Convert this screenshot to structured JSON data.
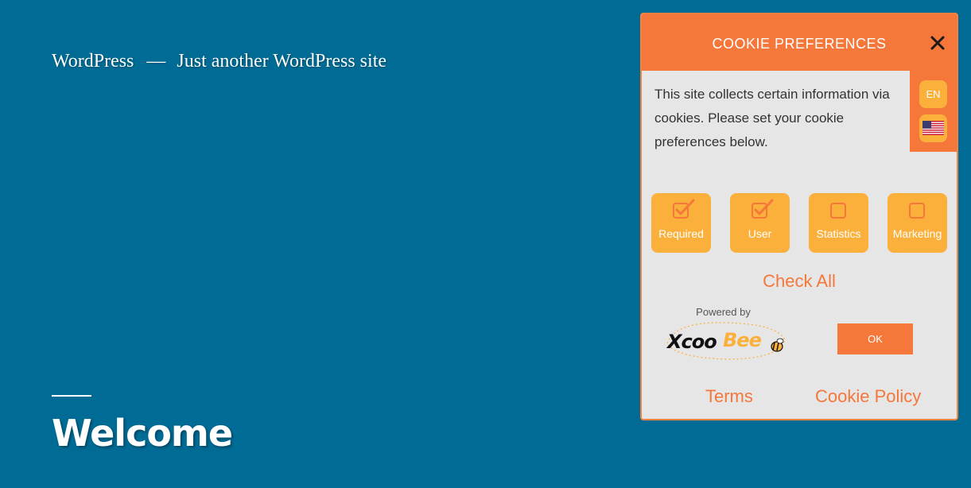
{
  "site": {
    "title": "WordPress",
    "separator": "—",
    "tagline": "Just another WordPress site",
    "heading": "Welcome"
  },
  "cookie": {
    "title": "COOKIE PREFERENCES",
    "close_icon": "close-icon",
    "language": "EN",
    "flag_icon": "us-flag-icon",
    "intro": "This site collects certain information via cookies. Please set your cookie preferences below.",
    "categories": [
      {
        "label": "Required",
        "checked": true
      },
      {
        "label": "User",
        "checked": true
      },
      {
        "label": "Statistics",
        "checked": false
      },
      {
        "label": "Marketing",
        "checked": false
      }
    ],
    "check_all": "Check All",
    "powered_by": "Powered by",
    "brand": "XcooBee",
    "ok": "OK",
    "terms": "Terms",
    "policy": "Cookie Policy"
  },
  "colors": {
    "page_background": "#006c96",
    "accent_orange": "#f5773a",
    "button_yellow": "#fbb03b",
    "panel_background": "#e6e6e6"
  }
}
